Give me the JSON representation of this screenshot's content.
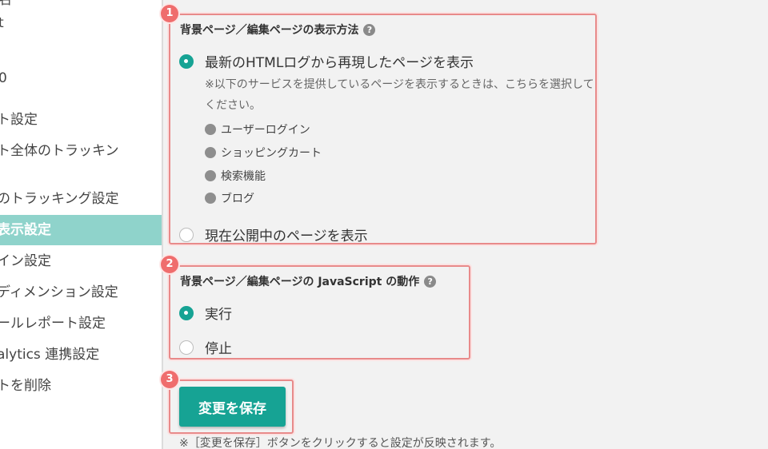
{
  "colors": {
    "accent": "#16a394",
    "sidebar_active": "#8fd3cb",
    "highlight": "#ef6d6d"
  },
  "sidebar": {
    "items": [
      {
        "label": "名"
      },
      {
        "label": "t"
      },
      {
        "label": "0"
      },
      {
        "label": "ト設定"
      },
      {
        "label": "ト全体のトラッキン"
      },
      {
        "label": "のトラッキング設定"
      },
      {
        "label": "表示設定"
      },
      {
        "label": "イン設定"
      },
      {
        "label": "ディメンション設定"
      },
      {
        "label": "ールレポート設定"
      },
      {
        "label": "alytics 連携設定"
      },
      {
        "label": "トを削除"
      }
    ]
  },
  "section1": {
    "badge": "1",
    "title": "背景ページ／編集ページの表示方法",
    "help": "?",
    "option_latest": "最新のHTMLログから再現したページを表示",
    "note": "※以下のサービスを提供しているページを表示するときは、こちらを選択してください。",
    "bullets": [
      "ユーザーログイン",
      "ショッピングカート",
      "検索機能",
      "ブログ"
    ],
    "option_current": "現在公開中のページを表示"
  },
  "section2": {
    "badge": "2",
    "title": "背景ページ／編集ページの JavaScript の動作",
    "help": "?",
    "option_run": "実行",
    "option_stop": "停止"
  },
  "section3": {
    "badge": "3",
    "save_label": "変更を保存",
    "footnote": "※［変更を保存］ボタンをクリックすると設定が反映されます。"
  }
}
